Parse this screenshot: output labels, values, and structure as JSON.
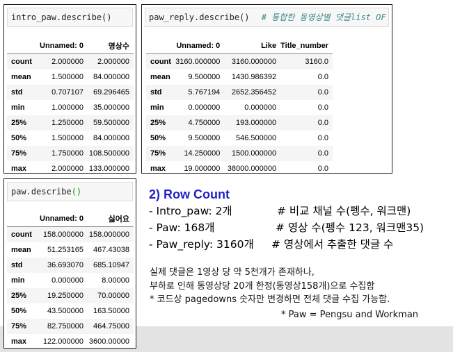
{
  "panels": [
    {
      "code": {
        "var": "intro_paw.describe",
        "paren": "()",
        "paren_style": "plain",
        "comment": ""
      },
      "columns": [
        "",
        "Unnamed: 0",
        "영상수"
      ],
      "rows": [
        [
          "count",
          "2.000000",
          "2.000000"
        ],
        [
          "mean",
          "1.500000",
          "84.000000"
        ],
        [
          "std",
          "0.707107",
          "69.296465"
        ],
        [
          "min",
          "1.000000",
          "35.000000"
        ],
        [
          "25%",
          "1.250000",
          "59.500000"
        ],
        [
          "50%",
          "1.500000",
          "84.000000"
        ],
        [
          "75%",
          "1.750000",
          "108.500000"
        ],
        [
          "max",
          "2.000000",
          "133.000000"
        ]
      ]
    },
    {
      "code": {
        "var": "paw_reply.describe",
        "paren": "()",
        "paren_style": "plain",
        "comment": "# 통합한 동영상별 댓글list OF 확인"
      },
      "columns": [
        "",
        "Unnamed: 0",
        "Like",
        "Title_number"
      ],
      "rows": [
        [
          "count",
          "3160.000000",
          "3160.000000",
          "3160.0"
        ],
        [
          "mean",
          "9.500000",
          "1430.986392",
          "0.0"
        ],
        [
          "std",
          "5.767194",
          "2652.356452",
          "0.0"
        ],
        [
          "min",
          "0.000000",
          "0.000000",
          "0.0"
        ],
        [
          "25%",
          "4.750000",
          "193.000000",
          "0.0"
        ],
        [
          "50%",
          "9.500000",
          "546.500000",
          "0.0"
        ],
        [
          "75%",
          "14.250000",
          "1500.000000",
          "0.0"
        ],
        [
          "max",
          "19.000000",
          "38000.000000",
          "0.0"
        ]
      ]
    },
    {
      "code": {
        "var": "paw.describe",
        "paren": "()",
        "paren_style": "green",
        "comment": ""
      },
      "columns": [
        "",
        "Unnamed: 0",
        "싫어요"
      ],
      "rows": [
        [
          "count",
          "158.000000",
          "158.000000"
        ],
        [
          "mean",
          "51.253165",
          "467.43038"
        ],
        [
          "std",
          "36.693070",
          "685.10947"
        ],
        [
          "min",
          "0.000000",
          "8.00000"
        ],
        [
          "25%",
          "19.250000",
          "70.00000"
        ],
        [
          "50%",
          "43.500000",
          "163.50000"
        ],
        [
          "75%",
          "82.750000",
          "464.75000"
        ],
        [
          "max",
          "122.000000",
          "3600.00000"
        ]
      ]
    }
  ],
  "info": {
    "title": "2) Row Count",
    "bullets": [
      {
        "text": "- Intro_paw: 2개",
        "note": "# 비교 채널 수(펭수, 워크맨)"
      },
      {
        "text": "- Paw: 168개",
        "note": "# 영상 수(펭수 123, 워크맨35)"
      },
      {
        "text": "- Paw_reply: 3160개",
        "note": "# 영상에서 추출한 댓글 수"
      }
    ],
    "notes": [
      "실제 댓글은 1영상 당 약 5천개가 존재하나,",
      "부하로 인해 동영상당 20개 한정(동영상158개)으로 수집함",
      "* 코드상 pagedowns 숫자만 변경하면 전체 댓글 수집 가능함."
    ],
    "footnote": "* Paw = Pengsu and Workman"
  }
}
